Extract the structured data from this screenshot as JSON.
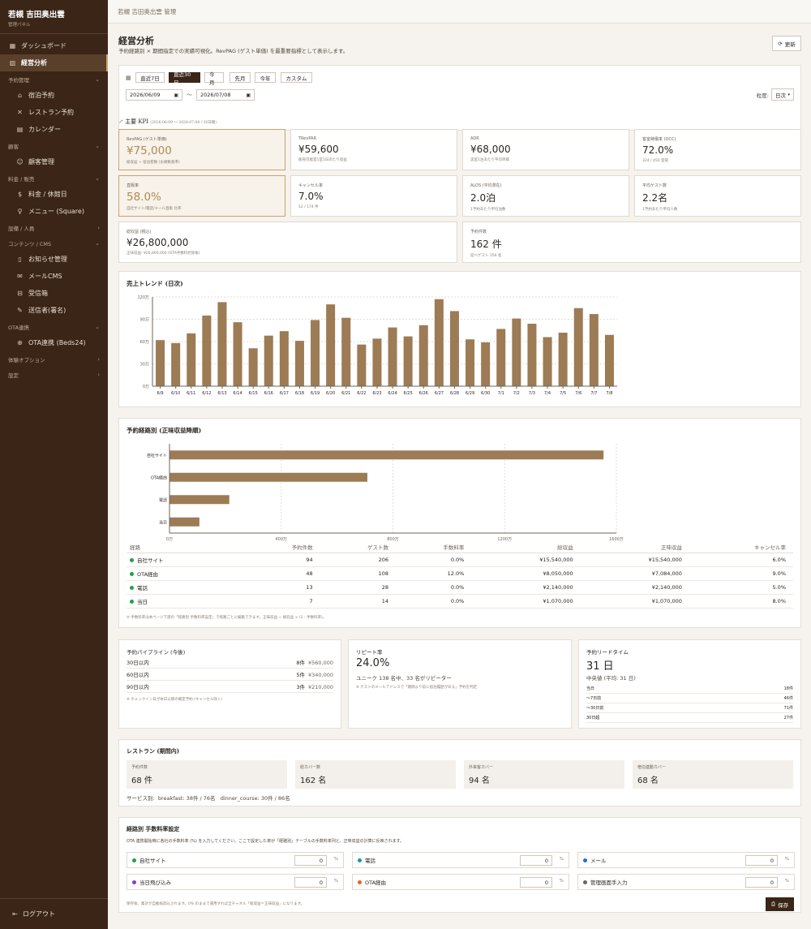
{
  "sidebar": {
    "brand_title": "若槻 吉田奥出雲",
    "brand_sub": "管理パネル",
    "items": [
      {
        "label": "ダッシュボード",
        "icon": "grid"
      },
      {
        "label": "経営分析",
        "icon": "chart"
      }
    ],
    "sections": [
      {
        "label": "予約管理",
        "items": [
          {
            "label": "宿泊予約",
            "icon": "bed"
          },
          {
            "label": "レストラン予約",
            "icon": "utensils"
          },
          {
            "label": "カレンダー",
            "icon": "calendar"
          }
        ]
      },
      {
        "label": "顧客",
        "items": [
          {
            "label": "顧客管理",
            "icon": "users"
          }
        ]
      },
      {
        "label": "料金 / 販売",
        "items": [
          {
            "label": "料金 / 休館日",
            "icon": "dollar"
          },
          {
            "label": "メニュー (Square)",
            "icon": "wine"
          }
        ]
      },
      {
        "label": "設備 / 人員",
        "items": []
      },
      {
        "label": "コンテンツ / CMS",
        "items": [
          {
            "label": "お知らせ管理",
            "icon": "doc"
          },
          {
            "label": "メールCMS",
            "icon": "mail"
          },
          {
            "label": "受信箱",
            "icon": "inbox"
          },
          {
            "label": "送信者(署名)",
            "icon": "pen"
          }
        ]
      },
      {
        "label": "OTA連携",
        "items": [
          {
            "label": "OTA連携 (Beds24)",
            "icon": "globe"
          }
        ]
      },
      {
        "label": "体験オプション",
        "items": []
      },
      {
        "label": "設定",
        "items": []
      }
    ],
    "logout": "ログアウト"
  },
  "topbar": {
    "title": "若槻 吉田奥出雲 管理"
  },
  "header": {
    "title": "経営分析",
    "subtitle": "予約経路別 × 期間指定での実績可視化。RevPAG (ゲスト単価) を最重要指標として表示します。",
    "refresh": "更新"
  },
  "period": {
    "buttons": [
      "直近7日",
      "直近30日",
      "今月",
      "先月",
      "今年",
      "カスタム"
    ],
    "active": "直近30日",
    "start": "2026/06/09",
    "end": "2026/07/08",
    "tilde": "〜",
    "granularity_label": "粒度:",
    "granularity": "日次"
  },
  "kpi": {
    "heading": "主要 KPI",
    "range": "(2026-06-09 〜 2026-07-08 / 30日間)",
    "cards": [
      {
        "label": "RevPAG (ゲスト単価)",
        "value": "¥75,000",
        "note": "総収益 ÷ 宿泊客数 (お頭数基準)",
        "hl": true
      },
      {
        "label": "TRevPAR",
        "value": "¥59,600",
        "note": "販売可能室1室1日あたり収益",
        "hl": false
      },
      {
        "label": "ADR",
        "value": "¥68,000",
        "note": "実室1泊あたり平均単価",
        "hl": false
      },
      {
        "label": "客室稼働率 (OCC)",
        "value": "72.0%",
        "note": "324 / 450 室夜",
        "hl": false
      },
      {
        "label": "直販率",
        "value": "58.0%",
        "note": "自社サイト/電話/メール直販 比率",
        "hl": true
      },
      {
        "label": "キャンセル率",
        "value": "7.0%",
        "note": "12 / 174 件",
        "hl": false
      },
      {
        "label": "ALOS (平均滞在)",
        "value": "2.0泊",
        "note": "1予約あたり平均泊数",
        "hl": false
      },
      {
        "label": "平均ゲスト数",
        "value": "2.2名",
        "note": "1予約あたり平均人数",
        "hl": false
      },
      {
        "label": "総収益 (税込)",
        "value": "¥26,800,000",
        "note": "正味収益: ¥26,800,000 (OTA手数料控除後)",
        "hl": false
      },
      {
        "label": "予約件数",
        "value": "162 件",
        "note": "延べゲスト 356 名",
        "hl": false
      }
    ]
  },
  "trend": {
    "title": "売上トレンド (日次)"
  },
  "channels": {
    "title": "予約経路別 (正味収益降順)",
    "headers": [
      "経路",
      "予約件数",
      "ゲスト数",
      "手数料率",
      "総収益",
      "正味収益",
      "キャンセル率"
    ],
    "rows": [
      {
        "name": "自社サイト",
        "count": "94",
        "guests": "206",
        "fee": "0.0%",
        "gross": "¥15,540,000",
        "net": "¥15,540,000",
        "cancel": "6.0%",
        "color": "#22a045"
      },
      {
        "name": "OTA経由",
        "count": "48",
        "guests": "108",
        "fee": "12.0%",
        "gross": "¥8,050,000",
        "net": "¥7,084,000",
        "cancel": "9.0%",
        "color": "#22a045"
      },
      {
        "name": "電話",
        "count": "13",
        "guests": "28",
        "fee": "0.0%",
        "gross": "¥2,140,000",
        "net": "¥2,140,000",
        "cancel": "5.0%",
        "color": "#22a045"
      },
      {
        "name": "当日",
        "count": "7",
        "guests": "14",
        "fee": "0.0%",
        "gross": "¥1,070,000",
        "net": "¥1,070,000",
        "cancel": "8.0%",
        "color": "#22a045"
      }
    ],
    "note": "※ 手数料率は本ページ下部の「経路別 手数料率設定」で経路ごとに編集できます。正味収益 = 総収益 × (1 - 手数料率)。"
  },
  "pipeline": {
    "title": "予約パイプライン (今後)",
    "rows": [
      {
        "label": "30日以内",
        "count": "8件",
        "amount": "¥560,000"
      },
      {
        "label": "60日以内",
        "count": "5件",
        "amount": "¥340,000"
      },
      {
        "label": "90日以内",
        "count": "3件",
        "amount": "¥210,000"
      }
    ],
    "note": "※ チェックイン日が本日以降の確定予約 (キャンセル除く)"
  },
  "repeat": {
    "title": "リピート率",
    "value": "24.0%",
    "sub": "ユニーク 138 名中、33 名がリピーター",
    "note": "※ ゲストのメールアドレスで「期間より前に宿泊履歴がある」予約を判定"
  },
  "leadtime": {
    "title": "予約リードタイム",
    "value": "31 日",
    "sub": "中央値 (平均: 31 日)",
    "rows": [
      {
        "label": "当日",
        "value": "18件"
      },
      {
        "label": "〜7日前",
        "value": "46件"
      },
      {
        "label": "〜30日前",
        "value": "71件"
      },
      {
        "label": "30日超",
        "value": "27件"
      }
    ]
  },
  "restaurant": {
    "title": "レストラン (期間内)",
    "boxes": [
      {
        "label": "予約件数",
        "value": "68 件"
      },
      {
        "label": "総カバー数",
        "value": "162 名"
      },
      {
        "label": "外来客カバー",
        "value": "94 名"
      },
      {
        "label": "宿泊連動カバー",
        "value": "68 名"
      }
    ],
    "service": "サービス別:  breakfast: 38件 / 76名   dinner_course: 30件 / 86名"
  },
  "fees": {
    "title": "経路別 手数料率設定",
    "desc": "OTA 連携開始時に各社の手数料率 (%) を入力してください。ここで設定した率が「経路別」テーブルの手数料率列と、正味収益の計算に反映されます。",
    "items": [
      {
        "name": "自社サイト",
        "value": "0",
        "color": "#22a045"
      },
      {
        "name": "電話",
        "value": "0",
        "color": "#1a9aa8"
      },
      {
        "name": "メール",
        "value": "0",
        "color": "#1f6fd1"
      },
      {
        "name": "当日飛び込み",
        "value": "0",
        "color": "#8a3ec9"
      },
      {
        "name": "OTA経由",
        "value": "0",
        "color": "#e06a1b"
      },
      {
        "name": "管理画面手入力",
        "value": "0",
        "color": "#666666"
      }
    ],
    "pct": "%",
    "note": "保存後、集計が自動再読込されます。0% のままで運用すれば全チャネル「総収益＝正味収益」になります。",
    "save": "保存"
  },
  "chart_data": [
    {
      "type": "bar",
      "title": "売上トレンド (日次)",
      "categories": [
        "6/9",
        "6/10",
        "6/11",
        "6/12",
        "6/13",
        "6/14",
        "6/15",
        "6/16",
        "6/17",
        "6/18",
        "6/19",
        "6/20",
        "6/21",
        "6/22",
        "6/23",
        "6/24",
        "6/25",
        "6/26",
        "6/27",
        "6/28",
        "6/29",
        "6/30",
        "7/1",
        "7/2",
        "7/3",
        "7/4",
        "7/5",
        "7/6",
        "7/7",
        "7/8"
      ],
      "values": [
        62,
        58,
        71,
        95,
        113,
        86,
        51,
        68,
        74,
        61,
        89,
        110,
        92,
        56,
        64,
        79,
        67,
        82,
        117,
        101,
        63,
        59,
        77,
        91,
        84,
        66,
        72,
        105,
        97,
        69
      ],
      "unit": "万",
      "yticks": [
        "0万",
        "30万",
        "60万",
        "90万",
        "120万"
      ],
      "ylim": [
        0,
        120
      ],
      "grid": true
    },
    {
      "type": "bar",
      "orientation": "horizontal",
      "categories": [
        "自社サイト",
        "OTA経由",
        "電話",
        "当日"
      ],
      "values": [
        1554,
        708.4,
        214,
        107
      ],
      "unit": "万",
      "xticks": [
        "0万",
        "400万",
        "800万",
        "1200万",
        "1600万"
      ],
      "xlim": [
        0,
        1600
      ],
      "grid": true
    }
  ]
}
